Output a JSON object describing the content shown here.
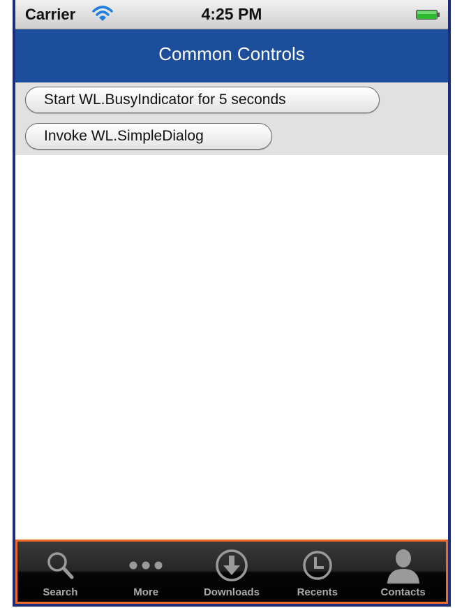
{
  "status_bar": {
    "carrier": "Carrier",
    "time": "4:25 PM",
    "wifi_icon": "wifi-icon",
    "battery_icon": "battery-icon",
    "battery_color": "#2fbb2f"
  },
  "header": {
    "title": "Common Controls",
    "background": "#1c4e9c"
  },
  "controls": {
    "busy_button_label": "Start WL.BusyIndicator for 5 seconds",
    "dialog_button_label": "Invoke WL.SimpleDialog"
  },
  "tab_bar": {
    "highlight_color": "#ec6a2c",
    "tabs": [
      {
        "label": "Search",
        "icon": "search-icon"
      },
      {
        "label": "More",
        "icon": "more-icon"
      },
      {
        "label": "Downloads",
        "icon": "download-icon"
      },
      {
        "label": "Recents",
        "icon": "clock-icon"
      },
      {
        "label": "Contacts",
        "icon": "contact-icon"
      }
    ]
  }
}
